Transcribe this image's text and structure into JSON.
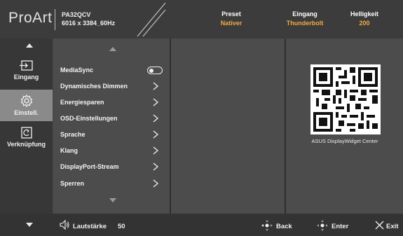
{
  "header": {
    "logo": "ProArt",
    "model": "PA32QCV",
    "resolution": "6016 x 3384_60Hz",
    "preset": {
      "label": "Preset",
      "value": "Nativer"
    },
    "input": {
      "label": "Eingang",
      "value": "Thunderbolt"
    },
    "brightness": {
      "label": "Helligkeit",
      "value": "200"
    }
  },
  "sidebar": {
    "items": [
      {
        "label": "Eingang",
        "icon": "input-icon"
      },
      {
        "label": "Einstell.",
        "icon": "gear-icon",
        "active": true
      },
      {
        "label": "Verknüpfung",
        "icon": "shortcut-icon"
      }
    ]
  },
  "menu": {
    "items": [
      {
        "label": "MediaSync",
        "control": "toggle",
        "toggle_on": false
      },
      {
        "label": "Dynamisches Dimmen",
        "control": "chevron"
      },
      {
        "label": "Energiesparen",
        "control": "chevron"
      },
      {
        "label": "OSD-Einstellungen",
        "control": "chevron"
      },
      {
        "label": "Sprache",
        "control": "chevron"
      },
      {
        "label": "Klang",
        "control": "chevron"
      },
      {
        "label": "DisplayPort-Stream",
        "control": "chevron"
      },
      {
        "label": "Sperren",
        "control": "chevron"
      }
    ]
  },
  "qr": {
    "caption": "ASUS DisplayWidget Center"
  },
  "bottom": {
    "volume_label": "Lautstärke",
    "volume_value": "50",
    "back": "Back",
    "enter": "Enter",
    "exit": "Exit"
  },
  "colors": {
    "accent": "#f2a941",
    "active_nav": "#8a8a8a"
  }
}
